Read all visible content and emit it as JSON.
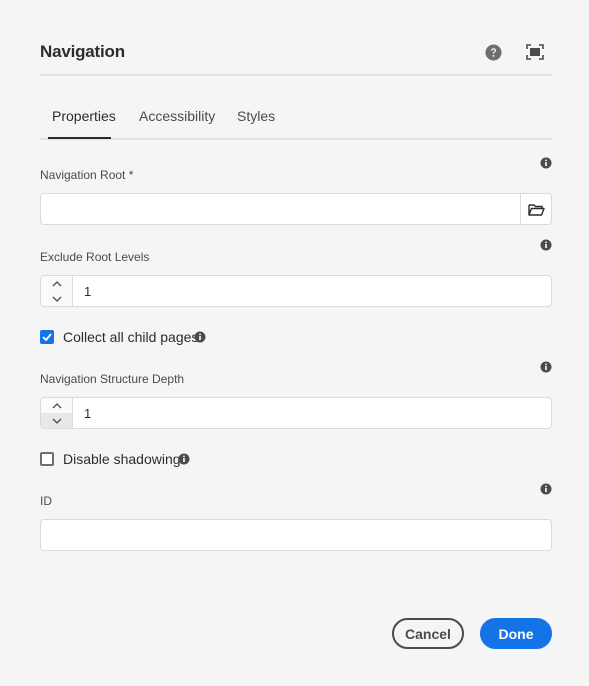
{
  "dialog": {
    "title": "Navigation",
    "help_icon": "help-icon",
    "fullscreen_icon": "fullscreen-icon"
  },
  "tabs": [
    {
      "label": "Properties",
      "active": true
    },
    {
      "label": "Accessibility",
      "active": false
    },
    {
      "label": "Styles",
      "active": false
    }
  ],
  "fields": {
    "navigation_root": {
      "label": "Navigation Root *",
      "value": "",
      "browse_icon": "folder-open-icon"
    },
    "exclude_root_levels": {
      "label": "Exclude Root Levels",
      "value": "1"
    },
    "collect_all_child_pages": {
      "label": "Collect all child pages",
      "checked": true
    },
    "navigation_structure_depth": {
      "label": "Navigation Structure Depth",
      "value": "1"
    },
    "disable_shadowing": {
      "label": "Disable shadowing",
      "checked": false
    },
    "id": {
      "label": "ID",
      "value": ""
    }
  },
  "footer": {
    "cancel_label": "Cancel",
    "done_label": "Done"
  },
  "colors": {
    "accent": "#1473e6",
    "background": "#f5f5f5",
    "text": "#2c2c2c"
  }
}
